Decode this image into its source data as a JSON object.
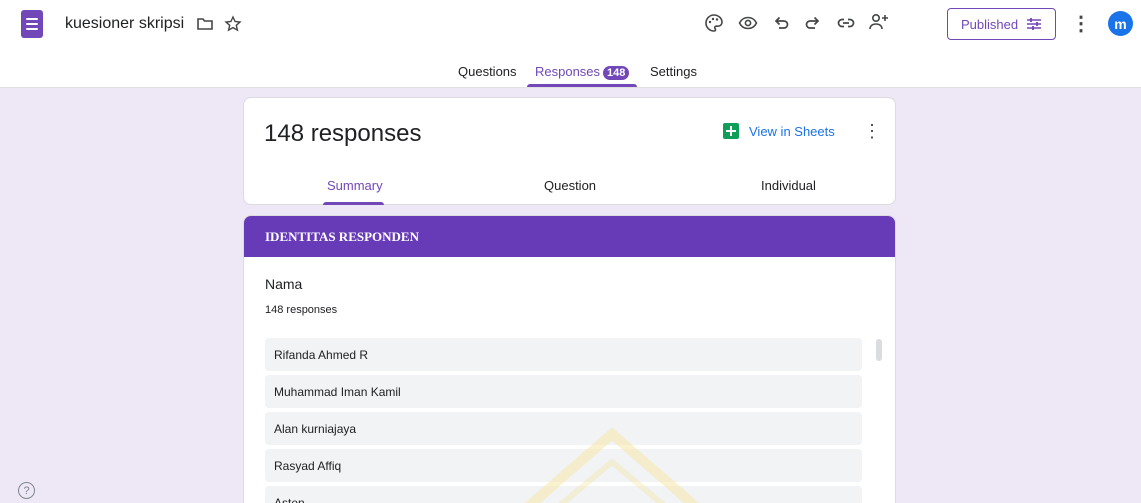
{
  "header": {
    "doc_title": "kuesioner skripsi",
    "published_label": "Published",
    "avatar_initial": "m",
    "icons": [
      "forms-app-icon",
      "folder-icon",
      "star-icon",
      "palette-icon",
      "eye-icon",
      "undo-icon",
      "redo-icon",
      "link-icon",
      "add-collaborator-icon",
      "tune-icon",
      "more-vert-icon",
      "help-icon"
    ]
  },
  "tabs": [
    {
      "label": "Questions"
    },
    {
      "label": "Responses",
      "badge": "148"
    },
    {
      "label": "Settings"
    }
  ],
  "summary": {
    "title": "148 responses",
    "sheets_label": "View in Sheets",
    "subtabs": [
      {
        "label": "Summary"
      },
      {
        "label": "Question"
      },
      {
        "label": "Individual"
      }
    ]
  },
  "section": {
    "header": "IDENTITAS RESPONDEN",
    "question": {
      "title": "Nama",
      "count": "148 responses",
      "answers": [
        "Rifanda Ahmed R",
        "Muhammad Iman Kamil",
        "Alan kurniajaya",
        "Rasyad Affiq",
        "Asten"
      ]
    }
  },
  "colors": {
    "accent": "#7248b9",
    "section_header": "#673ab7",
    "background": "#ede7f6",
    "link": "#1a73e8",
    "sheets_green": "#0f9d58"
  }
}
